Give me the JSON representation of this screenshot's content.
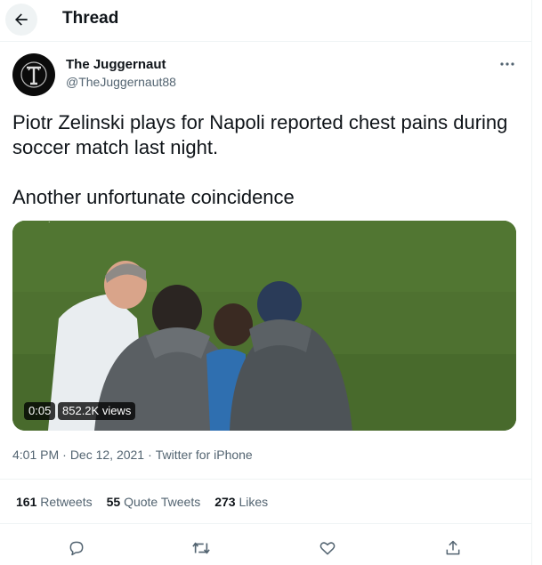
{
  "header": {
    "title": "Thread",
    "back_icon": "arrow-left-icon"
  },
  "author": {
    "name": "The Juggernaut",
    "handle": "@TheJuggernaut88",
    "avatar_letter": "T"
  },
  "tweet": {
    "text_line1": "Piotr Zelinski plays for Napoli reported chest pains during soccer match last night.",
    "text_line2": "Another unfortunate coincidence"
  },
  "media": {
    "duration": "0:05",
    "views": "852.2K views"
  },
  "meta": {
    "time": "4:01 PM",
    "date": "Dec 12, 2021",
    "source": "Twitter for iPhone",
    "separator": "·"
  },
  "stats": {
    "retweets_count": "161",
    "retweets_label": "Retweets",
    "quotes_count": "55",
    "quotes_label": "Quote Tweets",
    "likes_count": "273",
    "likes_label": "Likes"
  },
  "actions": [
    "reply-icon",
    "retweet-icon",
    "like-icon",
    "share-icon"
  ],
  "colors": {
    "text": "#0f1419",
    "secondary": "#536471",
    "border": "#eff3f4",
    "grass": "#4a6e2a"
  }
}
